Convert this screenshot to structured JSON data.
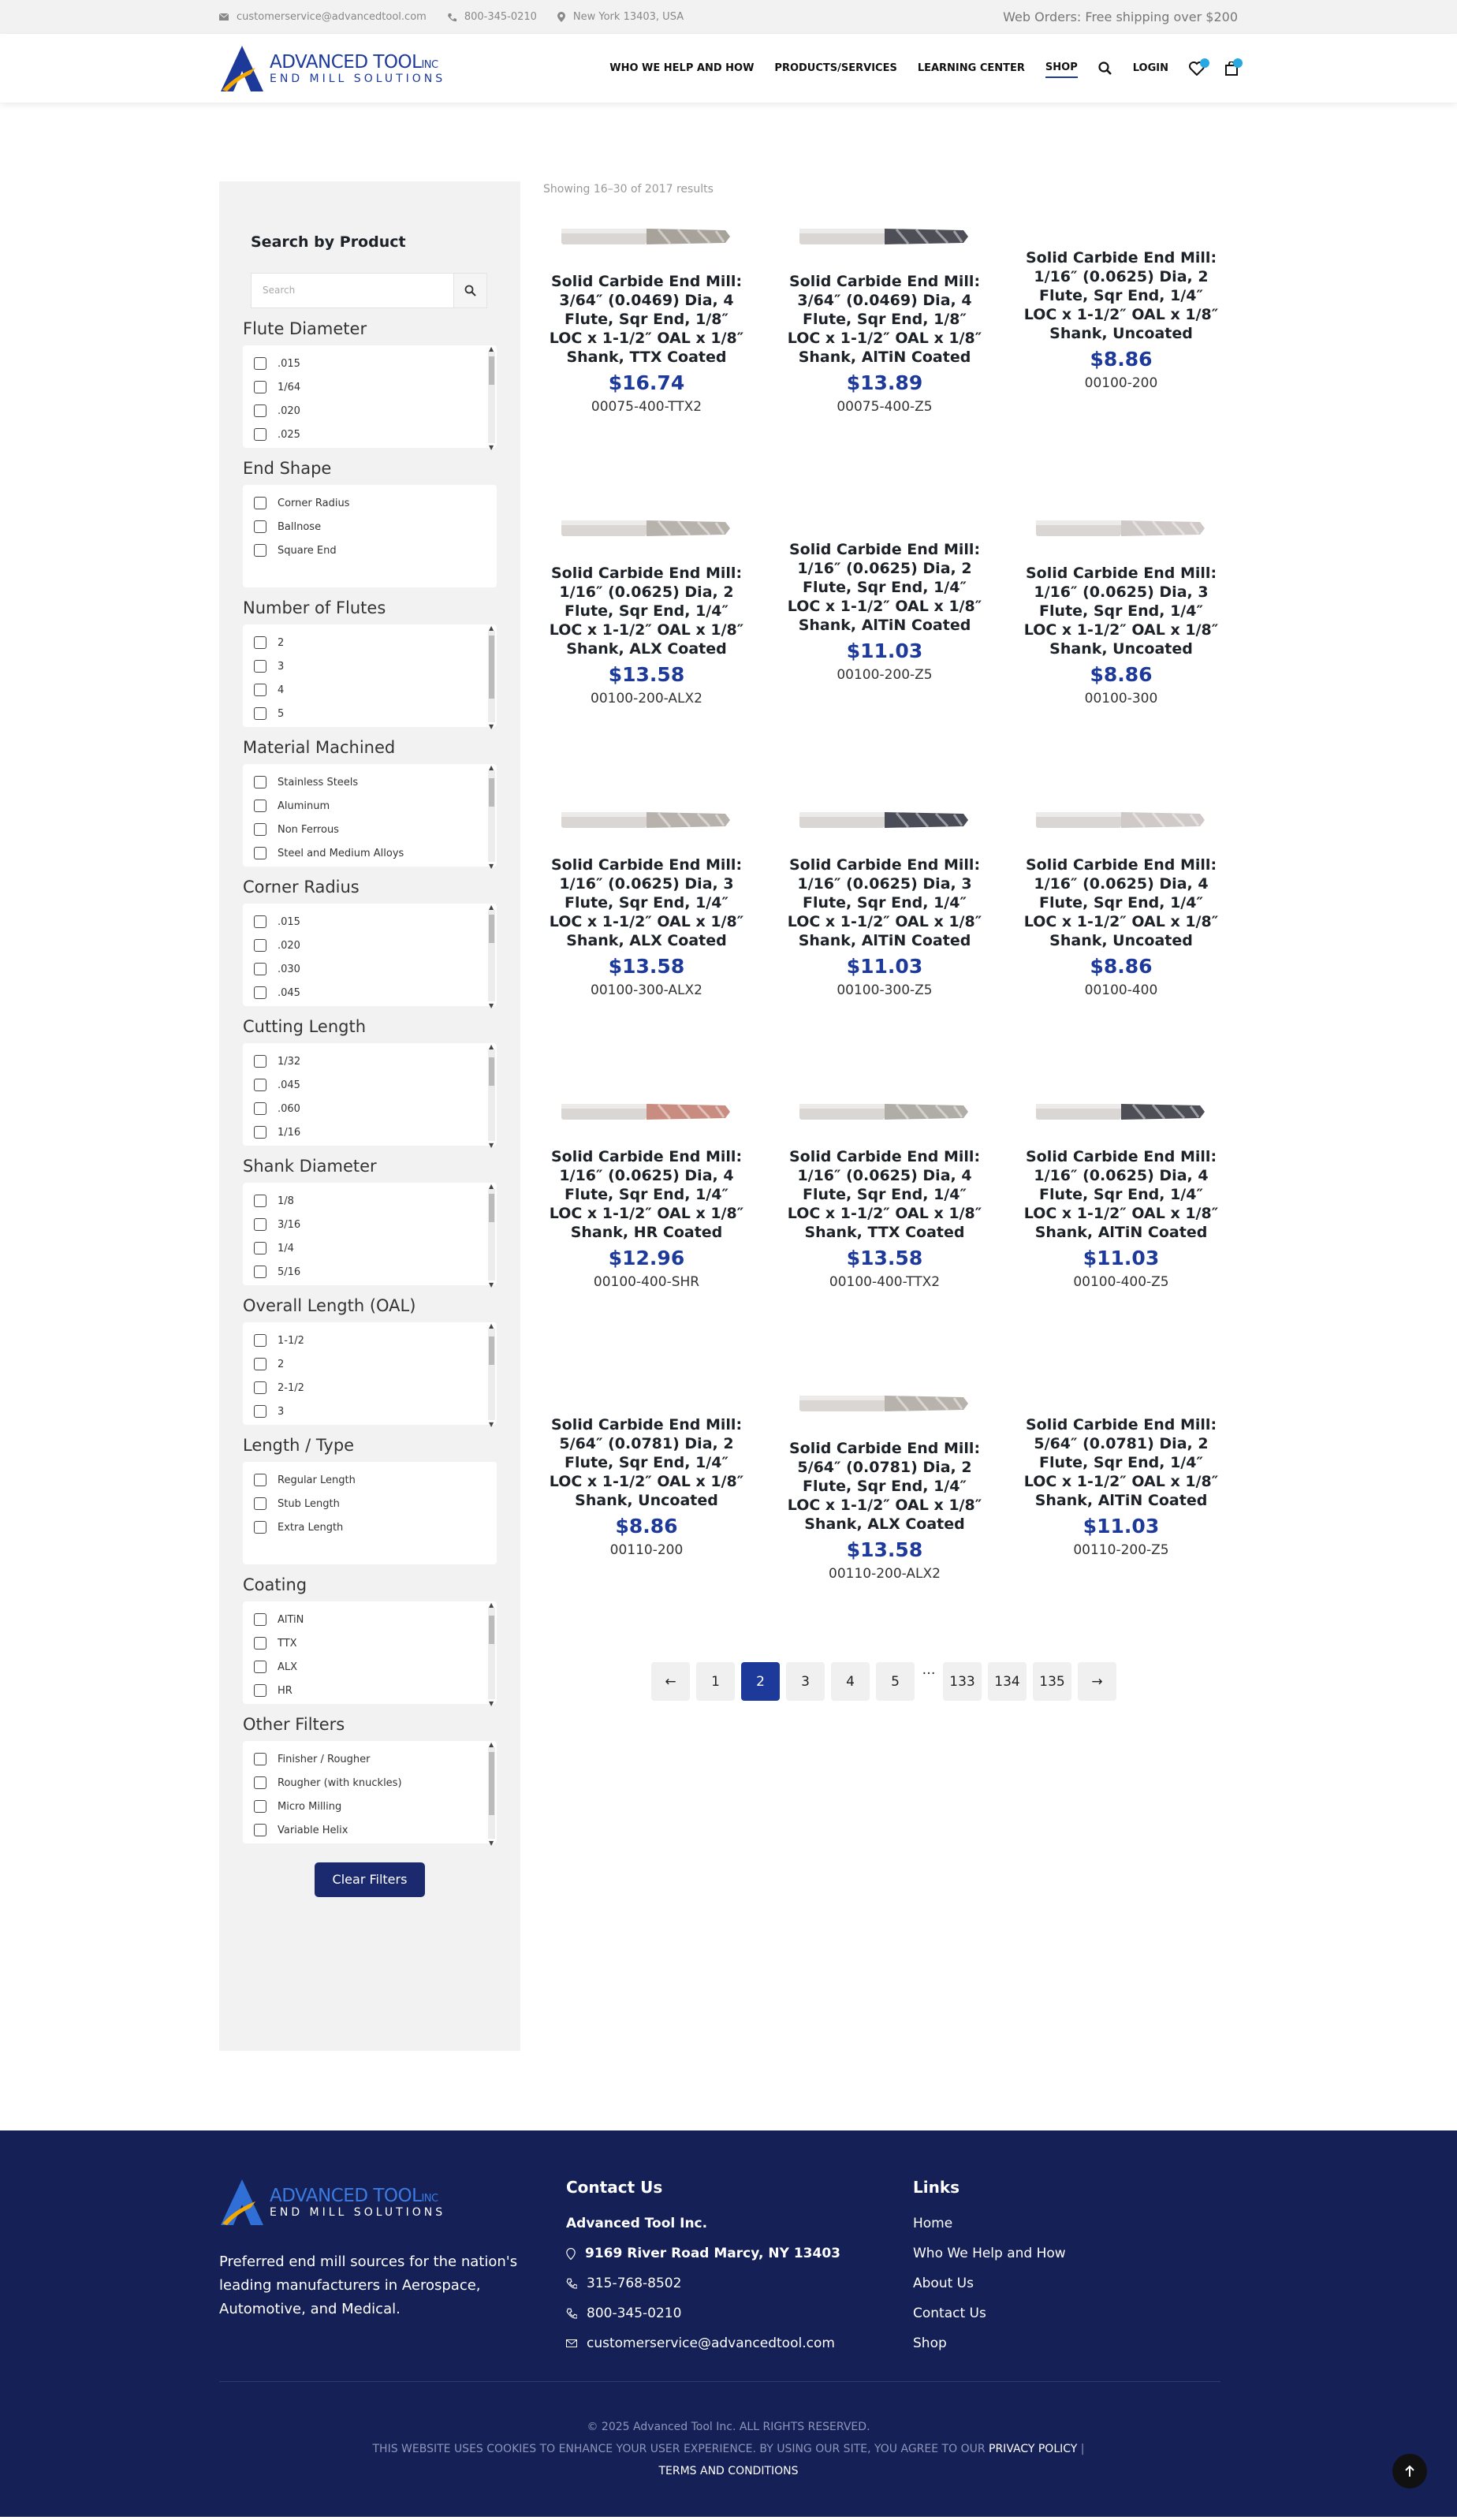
{
  "topbar": {
    "email": "customerservice@advancedtool.com",
    "phone": "800-345-0210",
    "location": "New York 13403, USA",
    "shipping": "Web Orders: Free shipping over $200"
  },
  "brand": {
    "name": "ADVANCED TOOL",
    "suffix": "INC",
    "tagline": "END MILL SOLUTIONS",
    "colors": {
      "accent": "#1d3a9a",
      "nav_dark": "#1b2a6e",
      "footer": "#142056",
      "badge": "#27a8e0"
    }
  },
  "nav": {
    "items": [
      "WHO WE HELP AND HOW",
      "PRODUCTS/SERVICES",
      "LEARNING CENTER",
      "SHOP"
    ],
    "login": "LOGIN",
    "active": "SHOP"
  },
  "sidebar": {
    "title": "Search by Product",
    "search_placeholder": "Search",
    "clear_label": "Clear Filters",
    "filters": [
      {
        "label": "Flute Diameter",
        "options": [
          ".015",
          "1/64",
          ".020",
          ".025"
        ]
      },
      {
        "label": "End Shape",
        "options": [
          "Corner Radius",
          "Ballnose",
          "Square End"
        ]
      },
      {
        "label": "Number of Flutes",
        "options": [
          "2",
          "3",
          "4",
          "5"
        ]
      },
      {
        "label": "Material Machined",
        "options": [
          "Stainless Steels",
          "Aluminum",
          "Non Ferrous",
          "Steel and Medium Alloys"
        ]
      },
      {
        "label": "Corner Radius",
        "options": [
          ".015",
          ".020",
          ".030",
          ".045"
        ]
      },
      {
        "label": "Cutting Length",
        "options": [
          "1/32",
          ".045",
          ".060",
          "1/16"
        ]
      },
      {
        "label": "Shank Diameter",
        "options": [
          "1/8",
          "3/16",
          "1/4",
          "5/16"
        ]
      },
      {
        "label": "Overall Length (OAL)",
        "options": [
          "1-1/2",
          "2",
          "2-1/2",
          "3"
        ]
      },
      {
        "label": "Length / Type",
        "options": [
          "Regular Length",
          "Stub Length",
          "Extra Length"
        ]
      },
      {
        "label": "Coating",
        "options": [
          "AlTiN",
          "TTX",
          "ALX",
          "HR"
        ]
      },
      {
        "label": "Other Filters",
        "options": [
          "Finisher / Rougher",
          "Rougher (with knuckles)",
          "Micro Milling",
          "Variable Helix"
        ]
      }
    ]
  },
  "results": {
    "summary": "Showing 16–30 of 2017 results"
  },
  "products": [
    {
      "name": "Solid Carbide End Mill: 3/64″ (0.0469) Dia, 4 Flute, Sqr End, 1/8″ LOC x 1-1/2″ OAL x 1/8″ Shank, TTX Coated",
      "price": "$16.74",
      "sku": "00075-400-TTX2",
      "tip": "#a8a39a",
      "img": true
    },
    {
      "name": "Solid Carbide End Mill: 3/64″ (0.0469) Dia, 4 Flute, Sqr End, 1/8″ LOC x 1-1/2″ OAL x 1/8″ Shank, AlTiN Coated",
      "price": "$13.89",
      "sku": "00075-400-Z5",
      "tip": "#4e4f56",
      "img": true
    },
    {
      "name": "Solid Carbide End Mill: 1/16″ (0.0625) Dia, 2 Flute, Sqr End, 1/4″ LOC x 1-1/2″ OAL x 1/8″ Shank, Uncoated",
      "price": "$8.86",
      "sku": "00100-200",
      "tip": "#c9c4c2",
      "img": false
    },
    {
      "name": "Solid Carbide End Mill: 1/16″ (0.0625) Dia, 2 Flute, Sqr End, 1/4″ LOC x 1-1/2″ OAL x 1/8″ Shank, ALX Coated",
      "price": "$13.58",
      "sku": "00100-200-ALX2",
      "tip": "#b8b2ad",
      "img": true
    },
    {
      "name": "Solid Carbide End Mill: 1/16″ (0.0625) Dia, 2 Flute, Sqr End, 1/4″ LOC x 1-1/2″ OAL x 1/8″ Shank, AlTiN Coated",
      "price": "$11.03",
      "sku": "00100-200-Z5",
      "tip": "#4e4f56",
      "img": false
    },
    {
      "name": "Solid Carbide End Mill: 1/16″ (0.0625) Dia, 3 Flute, Sqr End, 1/4″ LOC x 1-1/2″ OAL x 1/8″ Shank, Uncoated",
      "price": "$8.86",
      "sku": "00100-300",
      "tip": "#cfc9c7",
      "img": true
    },
    {
      "name": "Solid Carbide End Mill: 1/16″ (0.0625) Dia, 3 Flute, Sqr End, 1/4″ LOC x 1-1/2″ OAL x 1/8″ Shank, ALX Coated",
      "price": "$13.58",
      "sku": "00100-300-ALX2",
      "tip": "#b8b2ad",
      "img": true
    },
    {
      "name": "Solid Carbide End Mill: 1/16″ (0.0625) Dia, 3 Flute, Sqr End, 1/4″ LOC x 1-1/2″ OAL x 1/8″ Shank, AlTiN Coated",
      "price": "$11.03",
      "sku": "00100-300-Z5",
      "tip": "#4a4d58",
      "img": true
    },
    {
      "name": "Solid Carbide End Mill: 1/16″ (0.0625) Dia, 4 Flute, Sqr End, 1/4″ LOC x 1-1/2″ OAL x 1/8″ Shank, Uncoated",
      "price": "$8.86",
      "sku": "00100-400",
      "tip": "#cfc9c7",
      "img": true
    },
    {
      "name": "Solid Carbide End Mill: 1/16″ (0.0625) Dia, 4 Flute, Sqr End, 1/4″ LOC x 1-1/2″ OAL x 1/8″ Shank, HR Coated",
      "price": "$12.96",
      "sku": "00100-400-SHR",
      "tip": "#c98c80",
      "img": true
    },
    {
      "name": "Solid Carbide End Mill: 1/16″ (0.0625) Dia, 4 Flute, Sqr End, 1/4″ LOC x 1-1/2″ OAL x 1/8″ Shank, TTX Coated",
      "price": "$13.58",
      "sku": "00100-400-TTX2",
      "tip": "#b0aca6",
      "img": true
    },
    {
      "name": "Solid Carbide End Mill: 1/16″ (0.0625) Dia, 4 Flute, Sqr End, 1/4″ LOC x 1-1/2″ OAL x 1/8″ Shank, AlTiN Coated",
      "price": "$11.03",
      "sku": "00100-400-Z5",
      "tip": "#4e4f56",
      "img": true
    },
    {
      "name": "Solid Carbide End Mill: 5/64″ (0.0781) Dia, 2 Flute, Sqr End, 1/4″ LOC x 1-1/2″ OAL x 1/8″ Shank, Uncoated",
      "price": "$8.86",
      "sku": "00110-200",
      "tip": "#cfc9c7",
      "img": false
    },
    {
      "name": "Solid Carbide End Mill: 5/64″ (0.0781) Dia, 2 Flute, Sqr End, 1/4″ LOC x 1-1/2″ OAL x 1/8″ Shank, ALX Coated",
      "price": "$13.58",
      "sku": "00110-200-ALX2",
      "tip": "#b8b2ad",
      "img": true
    },
    {
      "name": "Solid Carbide End Mill: 5/64″ (0.0781) Dia, 2 Flute, Sqr End, 1/4″ LOC x 1-1/2″ OAL x 1/8″ Shank, AlTiN Coated",
      "price": "$11.03",
      "sku": "00110-200-Z5",
      "tip": "#4e4f56",
      "img": false
    }
  ],
  "pagination": {
    "prev": "←",
    "next": "→",
    "pages": [
      "1",
      "2",
      "3",
      "4",
      "5",
      "…",
      "133",
      "134",
      "135"
    ],
    "current": "2"
  },
  "footer": {
    "desc": "Preferred end mill sources for the nation's leading manufacturers in Aerospace, Automotive, and Medical.",
    "contact_title": "Contact Us",
    "company": "Advanced Tool Inc.",
    "address": "9169 River Road Marcy, NY 13403",
    "phone1": "315-768-8502",
    "phone2": "800-345-0210",
    "email": "customerservice@advancedtool.com",
    "links_title": "Links",
    "links": [
      "Home",
      "Who We Help and How",
      "About Us",
      "Contact Us",
      "Shop"
    ],
    "copyright": "© 2025 Advanced Tool Inc. ALL RIGHTS RESERVED.",
    "cookie": "THIS WEBSITE USES COOKIES TO ENHANCE YOUR USER EXPERIENCE. BY USING OUR SITE, YOU AGREE TO OUR",
    "privacy": "PRIVACY POLICY",
    "sep": "|",
    "terms": "TERMS AND CONDITIONS"
  }
}
